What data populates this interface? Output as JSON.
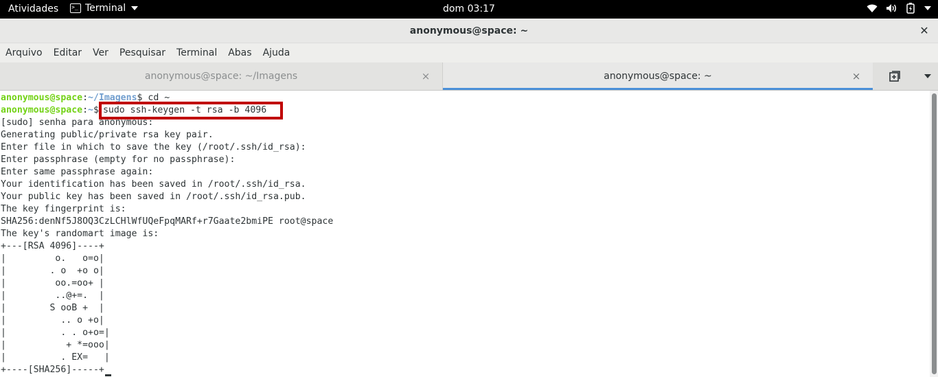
{
  "topbar": {
    "activities_label": "Atividades",
    "app_menu_label": "Terminal",
    "clock": "dom 03:17",
    "tray_icons": [
      "wifi-icon",
      "volume-icon",
      "battery-icon",
      "power-menu-caret"
    ]
  },
  "window": {
    "title": "anonymous@space: ~",
    "close_glyph": "✕"
  },
  "menubar": {
    "items": [
      "Arquivo",
      "Editar",
      "Ver",
      "Pesquisar",
      "Terminal",
      "Abas",
      "Ajuda"
    ]
  },
  "tabs": [
    {
      "label": "anonymous@space: ~/Imagens",
      "active": false,
      "close_glyph": "×"
    },
    {
      "label": "anonymous@space: ~",
      "active": true,
      "close_glyph": "×"
    }
  ],
  "terminal": {
    "prompt_user": "anonymous@space",
    "line1": {
      "path": "~/Imagens",
      "command": " cd ~"
    },
    "line2": {
      "path": "~",
      "command": "sudo ssh-keygen -t rsa -b 4096"
    },
    "output": [
      "[sudo] senha para anonymous:",
      "Generating public/private rsa key pair.",
      "Enter file in which to save the key (/root/.ssh/id_rsa):",
      "Enter passphrase (empty for no passphrase):",
      "Enter same passphrase again:",
      "Your identification has been saved in /root/.ssh/id_rsa.",
      "Your public key has been saved in /root/.ssh/id_rsa.pub.",
      "The key fingerprint is:",
      "SHA256:denNf5J8OQ3CzLCHlWfUQeFpqMARf+r7Gaate2bmiPE root@space",
      "The key's randomart image is:",
      "+---[RSA 4096]----+",
      "|         o.   o=o|",
      "|        . o  +o o|",
      "|         oo.=oo+ |",
      "|         ..@+=.  |",
      "|        S ooB +  |",
      "|          .. o +o|",
      "|          . . o+o=|",
      "|           + *=ooo|",
      "|          . EX=   |",
      "+----[SHA256]-----+"
    ]
  },
  "colors": {
    "accent_tab": "#4a90d9",
    "highlight_box": "#c00000",
    "prompt_user": "#73d216",
    "prompt_path": "#729fcf"
  }
}
